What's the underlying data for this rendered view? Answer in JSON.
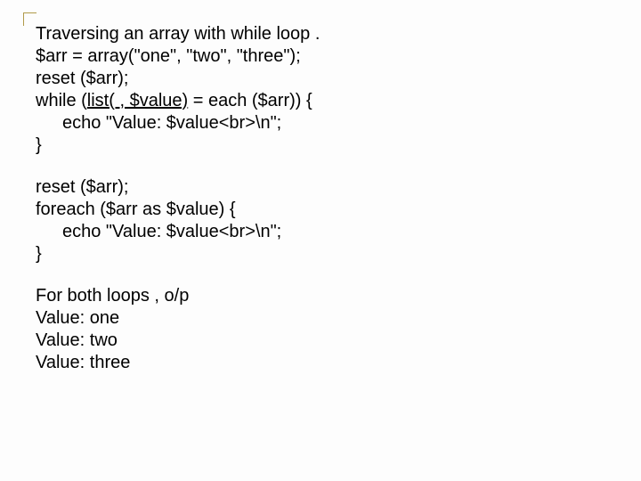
{
  "block1": {
    "l1": "Traversing an array with while loop .",
    "l2": "$arr = array(\"one\", \"two\", \"three\");",
    "l3": "reset ($arr);",
    "l4a": "while (",
    "l4b": "list( , $value)",
    "l4c": " = each ($arr)) {",
    "l5": "echo \"Value: $value<br>\\n\";",
    "l6": "}"
  },
  "block2": {
    "l1": "reset ($arr);",
    "l2": "foreach ($arr as $value) {",
    "l3": "echo \"Value: $value<br>\\n\";",
    "l4": "}"
  },
  "block3": {
    "l1": "For both loops , o/p",
    "l2": "Value: one",
    "l3": "Value: two",
    "l4": "Value: three"
  }
}
